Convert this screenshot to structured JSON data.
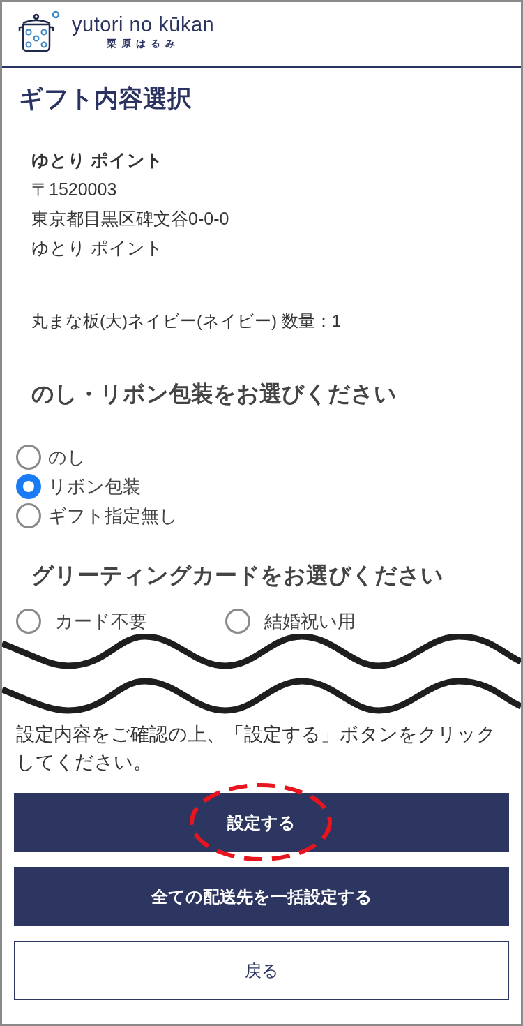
{
  "logo": {
    "name": "yutori no kūkan",
    "subtitle": "栗原はるみ"
  },
  "title": "ギフト内容選択",
  "address": {
    "name": "ゆとり ポイント",
    "postal": "〒1520003",
    "street": "東京都目黒区碑文谷0-0-0",
    "recipient": "ゆとり ポイント"
  },
  "item": "丸まな板(大)ネイビー(ネイビー) 数量：1",
  "noshi_section": {
    "heading": "のし・リボン包装をお選びください",
    "options": [
      {
        "label": "のし",
        "selected": false
      },
      {
        "label": "リボン包装",
        "selected": true
      },
      {
        "label": "ギフト指定無し",
        "selected": false
      }
    ]
  },
  "card_section": {
    "heading": "グリーティングカードをお選びください",
    "options": [
      {
        "label": "カード不要",
        "selected": false
      },
      {
        "label": "結婚祝い用",
        "selected": false
      }
    ]
  },
  "instruction": "設定内容をご確認の上、「設定する」ボタンをクリックしてください。",
  "buttons": [
    {
      "label": "設定する",
      "kind": "primary",
      "annotated": true
    },
    {
      "label": "全ての配送先を一括設定する",
      "kind": "primary",
      "annotated": false
    },
    {
      "label": "戻る",
      "kind": "secondary",
      "annotated": false
    }
  ]
}
